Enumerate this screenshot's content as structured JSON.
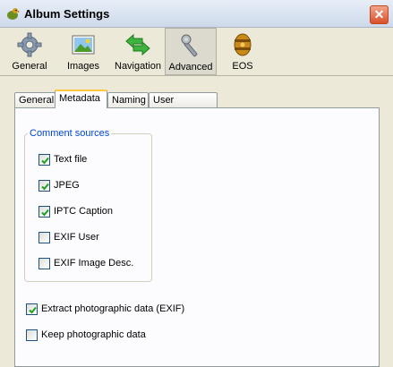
{
  "window": {
    "title": "Album Settings",
    "close_glyph": "✕"
  },
  "toolbar": {
    "buttons": [
      {
        "label": "General",
        "icon": "gear-icon"
      },
      {
        "label": "Images",
        "icon": "picture-icon"
      },
      {
        "label": "Navigation",
        "icon": "arrows-icon"
      },
      {
        "label": "Advanced",
        "icon": "tools-icon",
        "active": true
      },
      {
        "label": "EOS",
        "icon": "eos-icon"
      }
    ]
  },
  "tabs": [
    {
      "label": "General"
    },
    {
      "label": "Metadata",
      "active": true
    },
    {
      "label": "Naming"
    },
    {
      "label": "User Variables"
    }
  ],
  "comment_sources": {
    "legend": "Comment sources",
    "items": [
      {
        "label": "Text file",
        "checked": true
      },
      {
        "label": "JPEG",
        "checked": true
      },
      {
        "label": "IPTC Caption",
        "checked": true
      },
      {
        "label": "EXIF User",
        "checked": false
      },
      {
        "label": "EXIF Image Desc.",
        "checked": false
      }
    ]
  },
  "options": [
    {
      "label": "Extract photographic data (EXIF)",
      "checked": true
    },
    {
      "label": "Keep photographic data",
      "checked": false
    }
  ],
  "colors": {
    "accent_tab": "#ffc83c",
    "legend_text": "#0046d5",
    "checkmark": "#21a121"
  }
}
